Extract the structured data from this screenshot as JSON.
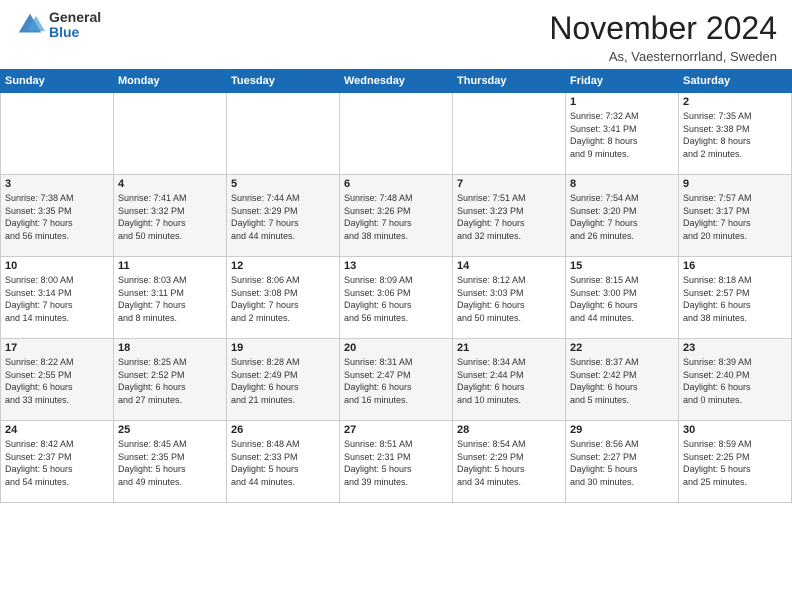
{
  "header": {
    "logo_general": "General",
    "logo_blue": "Blue",
    "month_title": "November 2024",
    "location": "As, Vaesternorrland, Sweden"
  },
  "days_of_week": [
    "Sunday",
    "Monday",
    "Tuesday",
    "Wednesday",
    "Thursday",
    "Friday",
    "Saturday"
  ],
  "weeks": [
    [
      {
        "day": "",
        "info": ""
      },
      {
        "day": "",
        "info": ""
      },
      {
        "day": "",
        "info": ""
      },
      {
        "day": "",
        "info": ""
      },
      {
        "day": "",
        "info": ""
      },
      {
        "day": "1",
        "info": "Sunrise: 7:32 AM\nSunset: 3:41 PM\nDaylight: 8 hours\nand 9 minutes."
      },
      {
        "day": "2",
        "info": "Sunrise: 7:35 AM\nSunset: 3:38 PM\nDaylight: 8 hours\nand 2 minutes."
      }
    ],
    [
      {
        "day": "3",
        "info": "Sunrise: 7:38 AM\nSunset: 3:35 PM\nDaylight: 7 hours\nand 56 minutes."
      },
      {
        "day": "4",
        "info": "Sunrise: 7:41 AM\nSunset: 3:32 PM\nDaylight: 7 hours\nand 50 minutes."
      },
      {
        "day": "5",
        "info": "Sunrise: 7:44 AM\nSunset: 3:29 PM\nDaylight: 7 hours\nand 44 minutes."
      },
      {
        "day": "6",
        "info": "Sunrise: 7:48 AM\nSunset: 3:26 PM\nDaylight: 7 hours\nand 38 minutes."
      },
      {
        "day": "7",
        "info": "Sunrise: 7:51 AM\nSunset: 3:23 PM\nDaylight: 7 hours\nand 32 minutes."
      },
      {
        "day": "8",
        "info": "Sunrise: 7:54 AM\nSunset: 3:20 PM\nDaylight: 7 hours\nand 26 minutes."
      },
      {
        "day": "9",
        "info": "Sunrise: 7:57 AM\nSunset: 3:17 PM\nDaylight: 7 hours\nand 20 minutes."
      }
    ],
    [
      {
        "day": "10",
        "info": "Sunrise: 8:00 AM\nSunset: 3:14 PM\nDaylight: 7 hours\nand 14 minutes."
      },
      {
        "day": "11",
        "info": "Sunrise: 8:03 AM\nSunset: 3:11 PM\nDaylight: 7 hours\nand 8 minutes."
      },
      {
        "day": "12",
        "info": "Sunrise: 8:06 AM\nSunset: 3:08 PM\nDaylight: 7 hours\nand 2 minutes."
      },
      {
        "day": "13",
        "info": "Sunrise: 8:09 AM\nSunset: 3:06 PM\nDaylight: 6 hours\nand 56 minutes."
      },
      {
        "day": "14",
        "info": "Sunrise: 8:12 AM\nSunset: 3:03 PM\nDaylight: 6 hours\nand 50 minutes."
      },
      {
        "day": "15",
        "info": "Sunrise: 8:15 AM\nSunset: 3:00 PM\nDaylight: 6 hours\nand 44 minutes."
      },
      {
        "day": "16",
        "info": "Sunrise: 8:18 AM\nSunset: 2:57 PM\nDaylight: 6 hours\nand 38 minutes."
      }
    ],
    [
      {
        "day": "17",
        "info": "Sunrise: 8:22 AM\nSunset: 2:55 PM\nDaylight: 6 hours\nand 33 minutes."
      },
      {
        "day": "18",
        "info": "Sunrise: 8:25 AM\nSunset: 2:52 PM\nDaylight: 6 hours\nand 27 minutes."
      },
      {
        "day": "19",
        "info": "Sunrise: 8:28 AM\nSunset: 2:49 PM\nDaylight: 6 hours\nand 21 minutes."
      },
      {
        "day": "20",
        "info": "Sunrise: 8:31 AM\nSunset: 2:47 PM\nDaylight: 6 hours\nand 16 minutes."
      },
      {
        "day": "21",
        "info": "Sunrise: 8:34 AM\nSunset: 2:44 PM\nDaylight: 6 hours\nand 10 minutes."
      },
      {
        "day": "22",
        "info": "Sunrise: 8:37 AM\nSunset: 2:42 PM\nDaylight: 6 hours\nand 5 minutes."
      },
      {
        "day": "23",
        "info": "Sunrise: 8:39 AM\nSunset: 2:40 PM\nDaylight: 6 hours\nand 0 minutes."
      }
    ],
    [
      {
        "day": "24",
        "info": "Sunrise: 8:42 AM\nSunset: 2:37 PM\nDaylight: 5 hours\nand 54 minutes."
      },
      {
        "day": "25",
        "info": "Sunrise: 8:45 AM\nSunset: 2:35 PM\nDaylight: 5 hours\nand 49 minutes."
      },
      {
        "day": "26",
        "info": "Sunrise: 8:48 AM\nSunset: 2:33 PM\nDaylight: 5 hours\nand 44 minutes."
      },
      {
        "day": "27",
        "info": "Sunrise: 8:51 AM\nSunset: 2:31 PM\nDaylight: 5 hours\nand 39 minutes."
      },
      {
        "day": "28",
        "info": "Sunrise: 8:54 AM\nSunset: 2:29 PM\nDaylight: 5 hours\nand 34 minutes."
      },
      {
        "day": "29",
        "info": "Sunrise: 8:56 AM\nSunset: 2:27 PM\nDaylight: 5 hours\nand 30 minutes."
      },
      {
        "day": "30",
        "info": "Sunrise: 8:59 AM\nSunset: 2:25 PM\nDaylight: 5 hours\nand 25 minutes."
      }
    ]
  ]
}
